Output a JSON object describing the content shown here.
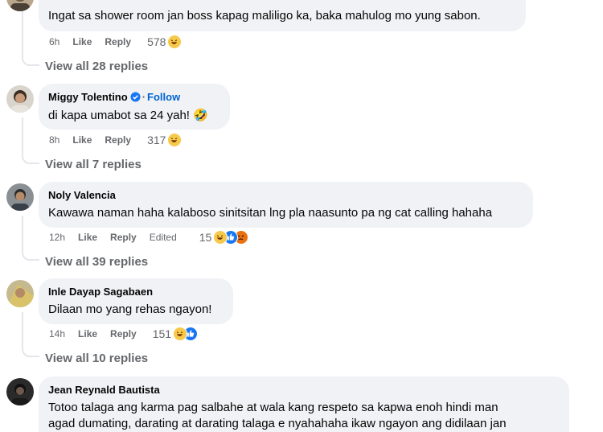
{
  "comments": [
    {
      "author": "",
      "text": "Ingat sa shower room jan boss kapag maliligo ka, baka mahulog mo yung sabon.",
      "time": "6h",
      "like_label": "Like",
      "reply_label": "Reply",
      "edited_label": "",
      "reaction_count": "578",
      "reactions": [
        "haha-icon"
      ],
      "view_replies": "View all 28 replies"
    },
    {
      "author": "Miggy Tolentino",
      "verified": true,
      "follow_label": "Follow",
      "text": "di kapa umabot sa 24 yah! 🤣",
      "time": "8h",
      "like_label": "Like",
      "reply_label": "Reply",
      "edited_label": "",
      "reaction_count": "317",
      "reactions": [
        "haha-icon"
      ],
      "view_replies": "View all 7 replies"
    },
    {
      "author": "Noly Valencia",
      "text": "Kawawa naman haha kalaboso sinitsitan lng pla naasunto pa ng cat calling hahaha",
      "time": "12h",
      "like_label": "Like",
      "reply_label": "Reply",
      "edited_label": "Edited",
      "reaction_count": "15",
      "reactions": [
        "haha-icon",
        "like-icon",
        "angry-icon"
      ],
      "view_replies": "View all 39 replies"
    },
    {
      "author": "Inle Dayap Sagabaen",
      "text": "Dilaan mo yang rehas ngayon!",
      "time": "14h",
      "like_label": "Like",
      "reply_label": "Reply",
      "edited_label": "",
      "reaction_count": "151",
      "reactions": [
        "haha-icon",
        "like-icon"
      ],
      "view_replies": "View all 10 replies"
    },
    {
      "author": "Jean Reynald Bautista",
      "text_line1": "Totoo talaga ang karma pag salbahe at wala kang respeto sa kapwa enoh hindi man",
      "text_line2": "agad dumating, darating at darating talaga e nyahahaha ikaw ngayon ang didilaan jan"
    }
  ],
  "colors": {
    "bubble": "#f0f2f5",
    "meta_text": "#65676b",
    "link_blue": "#0064d1",
    "thread_line": "#e4e6eb",
    "haha_yellow": "#f7c94b",
    "like_blue": "#1877f2",
    "angry_orange": "#e9710f"
  }
}
